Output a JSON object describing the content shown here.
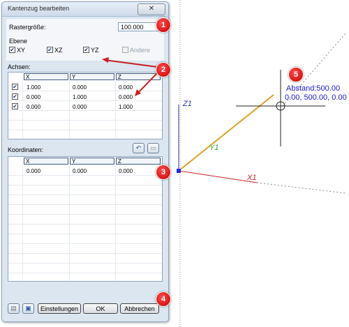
{
  "dialog": {
    "title": "Kantenzug bearbeiten",
    "close_glyph": "✕",
    "raster_label": "Rastergröße:",
    "raster_value": "100.000",
    "ebene_label": "Ebene",
    "planes": [
      {
        "label": "XY",
        "checked": true
      },
      {
        "label": "XZ",
        "checked": true
      },
      {
        "label": "YZ",
        "checked": true
      },
      {
        "label": "Andere",
        "checked": false
      }
    ],
    "achsen_label": "Achsen:",
    "axes_columns": [
      "X",
      "Y",
      "Z"
    ],
    "axes_rows": [
      {
        "checked": true,
        "x": "1.000",
        "y": "0.000",
        "z": "0.000"
      },
      {
        "checked": true,
        "x": "0.000",
        "y": "1.000",
        "z": "0.000"
      },
      {
        "checked": true,
        "x": "0.000",
        "y": "0.000",
        "z": "1.000"
      }
    ],
    "koordinaten_label": "Koordinaten:",
    "coord_columns": [
      "X",
      "Y",
      "Z"
    ],
    "coord_rows": [
      {
        "x": "0.000",
        "y": "0.000",
        "z": "0.000"
      }
    ],
    "buttons": {
      "einstellungen": "Einstellungen",
      "ok": "OK",
      "abbrechen": "Abbrechen"
    },
    "check_glyph": "✔"
  },
  "badges": [
    "1",
    "2",
    "3",
    "4",
    "5"
  ],
  "viewport": {
    "axis_x": "X1",
    "axis_y": "Y1",
    "axis_z": "Z1",
    "distance_label": "Abstand:500.00",
    "coords_label": "0.00, 500.00, 0.00"
  },
  "colors": {
    "badge_red": "#d40000",
    "axis_x": "#cc2222",
    "axis_y": "#33aa33",
    "axis_z": "#2233aa",
    "edge": "#e0a020",
    "annotation_blue": "#1a1acc"
  }
}
